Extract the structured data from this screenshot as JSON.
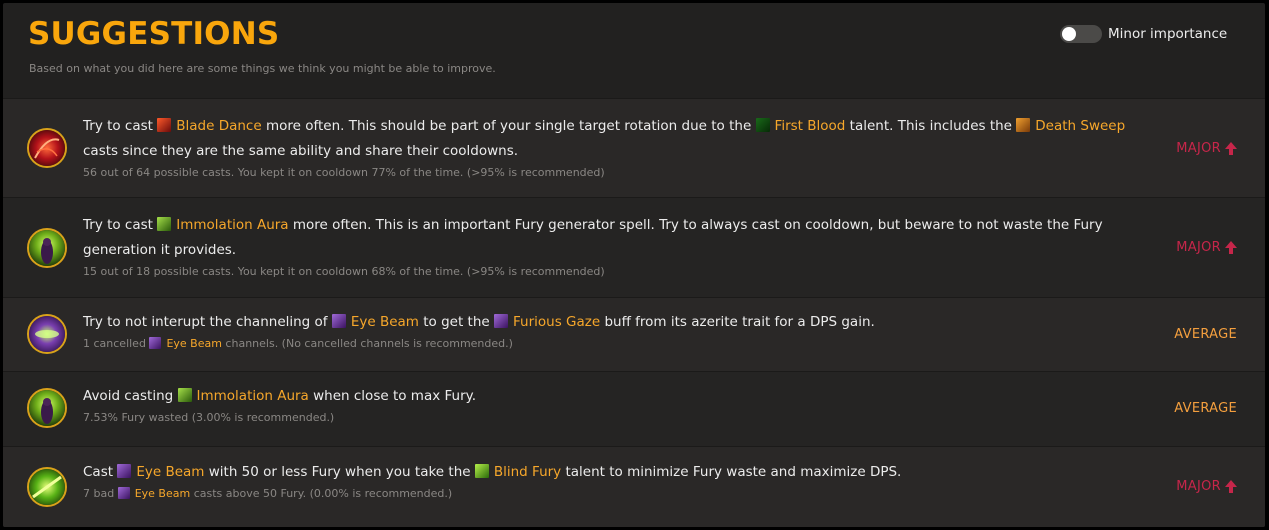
{
  "header": {
    "title": "SUGGESTIONS",
    "subtitle": "Based on what you did here are some things we think you might be able to improve.",
    "toggle_label": "Minor importance"
  },
  "colors": {
    "accent": "#f9a60c",
    "major": "#c6264a",
    "average": "#f49f3e",
    "spell": "#f6a72b"
  },
  "spells": {
    "blade_dance": "Blade Dance",
    "first_blood": "First Blood",
    "death_sweep": "Death Sweep",
    "immolation_aura": "Immolation Aura",
    "eye_beam": "Eye Beam",
    "furious_gaze": "Furious Gaze",
    "blind_fury": "Blind Fury"
  },
  "suggestions": [
    {
      "icon": "blade-dance-icon",
      "t1": "Try to cast ",
      "t2": " more often. This should be part of your single target rotation due to the ",
      "t3": " talent. This includes the ",
      "t4": " casts since they are the same ability and share their cooldowns.",
      "detail": "56 out of 64 possible casts. You kept it on cooldown 77% of the time. (>95% is recommended)",
      "importance": "MAJOR"
    },
    {
      "icon": "immolation-aura-icon",
      "t1": "Try to cast ",
      "t2": " more often. This is an important Fury generator spell. Try to always cast on cooldown, but beware to not waste the Fury generation it provides.",
      "detail": "15 out of 18 possible casts. You kept it on cooldown 68% of the time. (>95% is recommended)",
      "importance": "MAJOR"
    },
    {
      "icon": "eye-beam-icon",
      "t1": "Try to not interupt the channeling of ",
      "t2": " to get the ",
      "t3": " buff from its azerite trait for a DPS gain.",
      "d1": "1 cancelled ",
      "d2": " channels. (No cancelled channels is recommended.)",
      "importance": "AVERAGE"
    },
    {
      "icon": "immolation-aura-icon",
      "t1": "Avoid casting ",
      "t2": " when close to max Fury.",
      "detail": "7.53% Fury wasted (3.00% is recommended.)",
      "importance": "AVERAGE"
    },
    {
      "icon": "blind-fury-icon",
      "t1": "Cast ",
      "t2": " with 50 or less Fury when you take the ",
      "t3": " talent to minimize Fury waste and maximize DPS.",
      "d1": "7 bad ",
      "d2": " casts above 50 Fury. (0.00% is recommended.)",
      "importance": "MAJOR"
    }
  ]
}
